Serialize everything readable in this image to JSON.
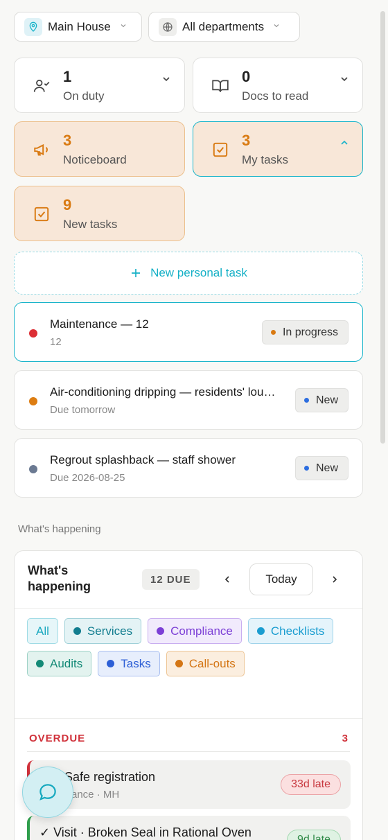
{
  "selectors": {
    "house": "Main House",
    "department": "All departments"
  },
  "stats": {
    "on_duty": {
      "count": "1",
      "label": "On duty"
    },
    "docs": {
      "count": "0",
      "label": "Docs to read"
    },
    "noticeboard": {
      "count": "3",
      "label": "Noticeboard"
    },
    "my_tasks": {
      "count": "3",
      "label": "My tasks"
    },
    "new_tasks": {
      "count": "9",
      "label": "New tasks"
    }
  },
  "new_personal_task": "New personal task",
  "tasks": [
    {
      "title": "Maintenance — 12",
      "sub": "12",
      "status": "In progress",
      "dot": "#dc2f35",
      "status_dot": "#d97a12"
    },
    {
      "title": "Air-conditioning dripping — residents' lounge",
      "sub": "Due tomorrow",
      "status": "New",
      "dot": "#dd7d12",
      "status_dot": "#2d6ee0"
    },
    {
      "title": "Regrout splashback — staff shower",
      "sub": "Due 2026-08-25",
      "status": "New",
      "dot": "#6b7a92",
      "status_dot": "#2d6ee0"
    }
  ],
  "section_caption": "What's happening",
  "happening": {
    "title": "What's happening",
    "due_badge": "12 DUE",
    "today": "Today",
    "filters": [
      {
        "label": "All",
        "color": "#1aa9c0",
        "bg": "#e6f6f9",
        "border": "#9fdbe5",
        "dot": ""
      },
      {
        "label": "Services",
        "color": "#127d8f",
        "bg": "#e4f3f5",
        "border": "#9fd0d8",
        "dot": "#127d8f"
      },
      {
        "label": "Compliance",
        "color": "#7c3fd6",
        "bg": "#f1eafc",
        "border": "#c8adf0",
        "dot": "#7c3fd6"
      },
      {
        "label": "Checklists",
        "color": "#1a9dd0",
        "bg": "#e5f4fb",
        "border": "#9fd3ea",
        "dot": "#1a9dd0"
      },
      {
        "label": "Audits",
        "color": "#148a77",
        "bg": "#e3f3ef",
        "border": "#9fd2c7",
        "dot": "#148a77"
      },
      {
        "label": "Tasks",
        "color": "#2d5fd6",
        "bg": "#e7eefc",
        "border": "#a9bff0",
        "dot": "#2d5fd6"
      },
      {
        "label": "Call-outs",
        "color": "#d47615",
        "bg": "#fbeedf",
        "border": "#edc595",
        "dot": "#d47615"
      }
    ],
    "overdue_label": "OVERDUE",
    "overdue_count": "3",
    "overdue_items": [
      {
        "title": "Safe registration",
        "sub": "ance · MH",
        "late": "33d late",
        "accent": "#d0313a",
        "late_color": "#c8383f",
        "late_bg": "#fbe0e0",
        "late_border": "#eba3a6"
      },
      {
        "title": "✓ Visit · Broken Seal in Rational Oven",
        "sub": "",
        "late": "9d late",
        "accent": "#2f9e4c",
        "late_color": "#2f8a47",
        "late_bg": "#dff2e3",
        "late_border": "#a3d8b0"
      }
    ]
  }
}
